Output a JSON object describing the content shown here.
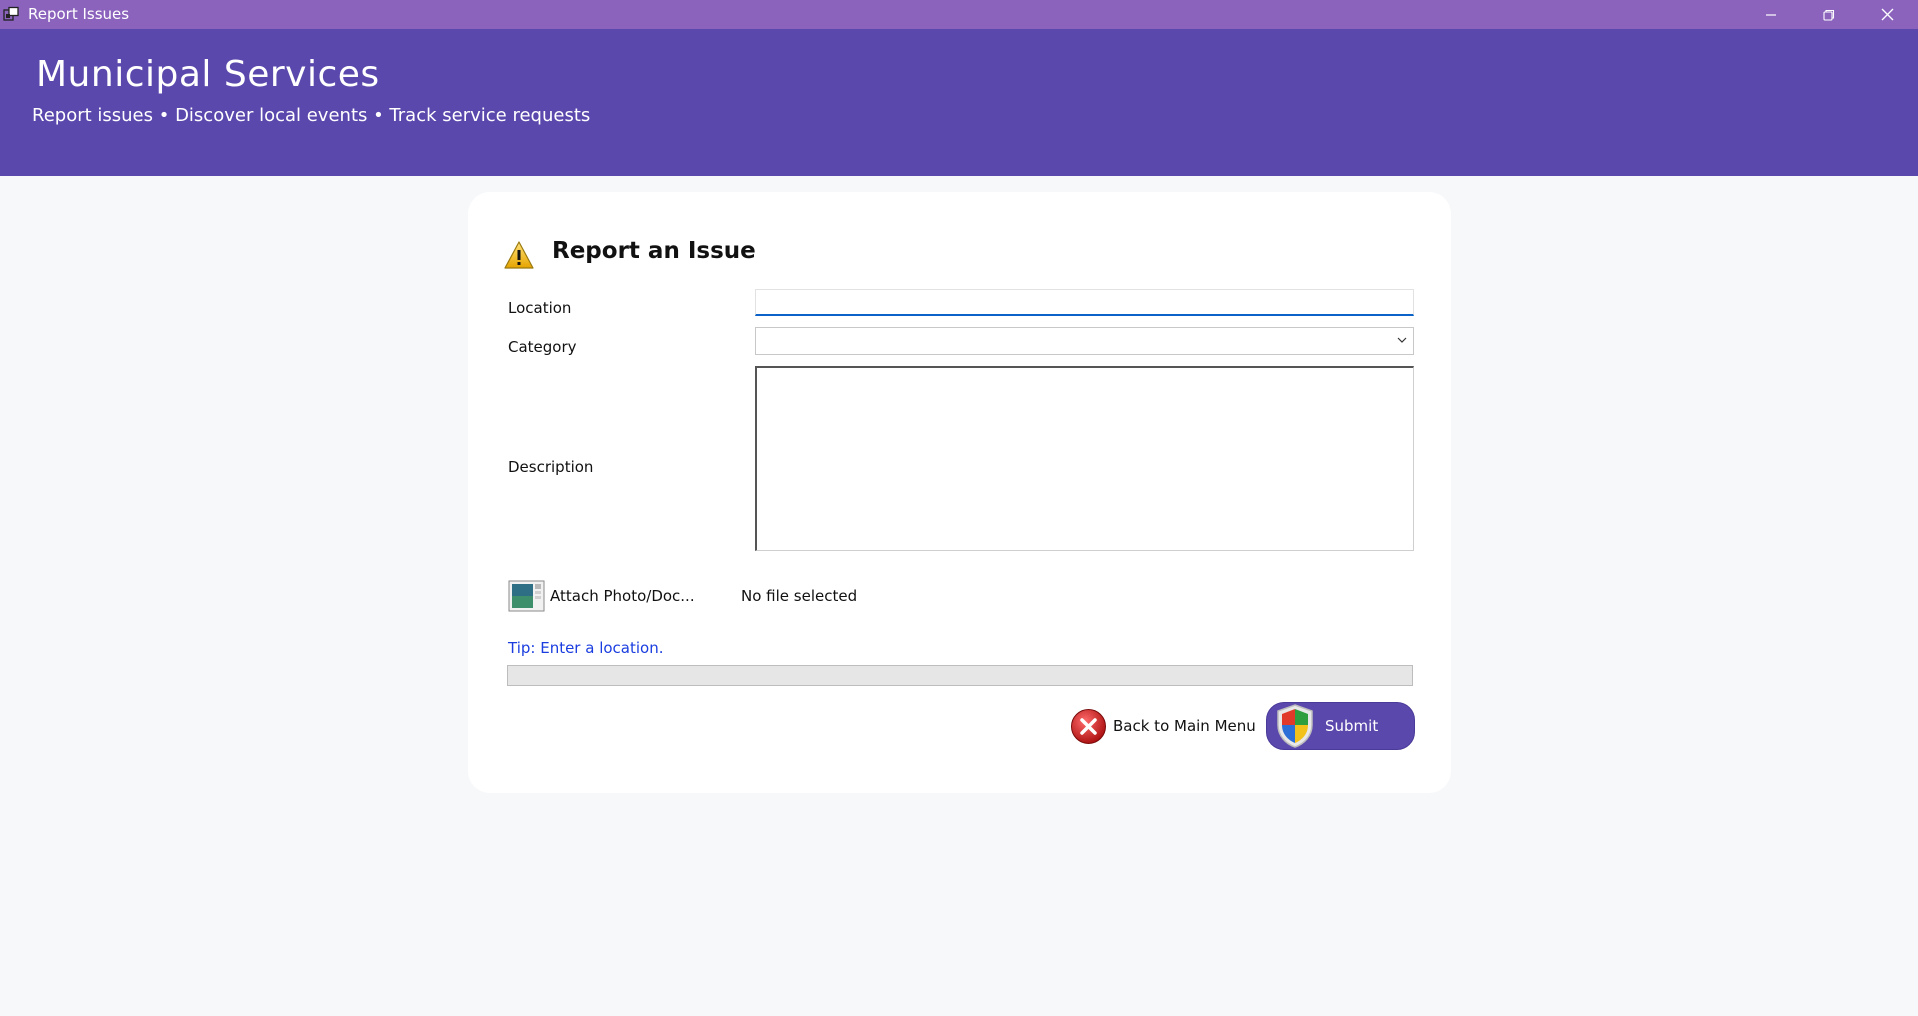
{
  "window": {
    "title": "Report Issues",
    "app_icon": "window-app-icon",
    "controls": [
      "minimize-icon",
      "restore-icon",
      "close-icon"
    ]
  },
  "header": {
    "title": "Municipal Services",
    "subtitle": "Report issues • Discover local events • Track service requests"
  },
  "form": {
    "title": "Report an Issue",
    "title_icon": "warning-icon",
    "location": {
      "label": "Location",
      "value": "",
      "placeholder": ""
    },
    "category": {
      "label": "Category",
      "value": ""
    },
    "description": {
      "label": "Description",
      "value": ""
    },
    "attach": {
      "label": "Attach Photo/Doc...",
      "icon": "image-attach-icon"
    },
    "file_status": "No file selected",
    "tip": "Tip: Enter a location.",
    "progress": 0,
    "back_button": {
      "label": "Back to Main Menu",
      "icon": "cancel-circle-icon"
    },
    "submit_button": {
      "label": "Submit",
      "icon": "shield-icon"
    }
  },
  "colors": {
    "titlebar": "#8b63bd",
    "header": "#5b48ad",
    "accent_blue": "#0b62c9",
    "tip_text": "#1a3de0",
    "page_bg": "#f7f8fa",
    "card_bg": "#ffffff"
  }
}
